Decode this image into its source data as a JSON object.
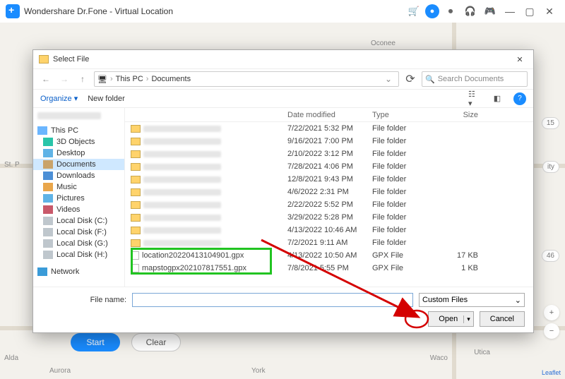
{
  "app": {
    "title": "Wondershare Dr.Fone - Virtual Location"
  },
  "map": {
    "leaflet": "Leaflet",
    "start": "Start",
    "clear": "Clear",
    "cities": [
      "Aurora",
      "York",
      "St. P",
      "Alda",
      "Waco",
      "Utica",
      "Oconee"
    ],
    "capsules": [
      "15",
      "ity",
      "46"
    ]
  },
  "dialog": {
    "title": "Select File",
    "crumbs": [
      "This PC",
      "Documents"
    ],
    "search_ph": "Search Documents",
    "organize": "Organize",
    "newfolder": "New folder",
    "columns": {
      "date": "Date modified",
      "type": "Type",
      "size": "Size"
    },
    "rows": [
      {
        "date": "7/22/2021 5:32 PM",
        "type": "File folder",
        "size": ""
      },
      {
        "date": "9/16/2021 7:00 PM",
        "type": "File folder",
        "size": ""
      },
      {
        "date": "2/10/2022 3:12 PM",
        "type": "File folder",
        "size": ""
      },
      {
        "date": "7/28/2021 4:06 PM",
        "type": "File folder",
        "size": ""
      },
      {
        "date": "12/8/2021 9:43 PM",
        "type": "File folder",
        "size": ""
      },
      {
        "date": "4/6/2022 2:31 PM",
        "type": "File folder",
        "size": ""
      },
      {
        "date": "2/22/2022 5:52 PM",
        "type": "File folder",
        "size": ""
      },
      {
        "date": "3/29/2022 5:28 PM",
        "type": "File folder",
        "size": ""
      },
      {
        "date": "4/13/2022 10:46 AM",
        "type": "File folder",
        "size": ""
      },
      {
        "date": "7/2/2021 9:11 AM",
        "type": "File folder",
        "size": ""
      },
      {
        "name": "location20220413104901.gpx",
        "date": "4/13/2022 10:50 AM",
        "type": "GPX File",
        "size": "17 KB"
      },
      {
        "name": "mapstogpx202107817551.gpx",
        "date": "7/8/2021 5:55 PM",
        "type": "GPX File",
        "size": "1 KB"
      }
    ],
    "sidebar": {
      "thispc": "This PC",
      "items": [
        "3D Objects",
        "Desktop",
        "Documents",
        "Downloads",
        "Music",
        "Pictures",
        "Videos",
        "Local Disk (C:)",
        "Local Disk (F:)",
        "Local Disk (G:)",
        "Local Disk (H:)"
      ],
      "network": "Network"
    },
    "footer": {
      "fname": "File name:",
      "filter": "Custom Files",
      "open": "Open",
      "cancel": "Cancel"
    }
  }
}
